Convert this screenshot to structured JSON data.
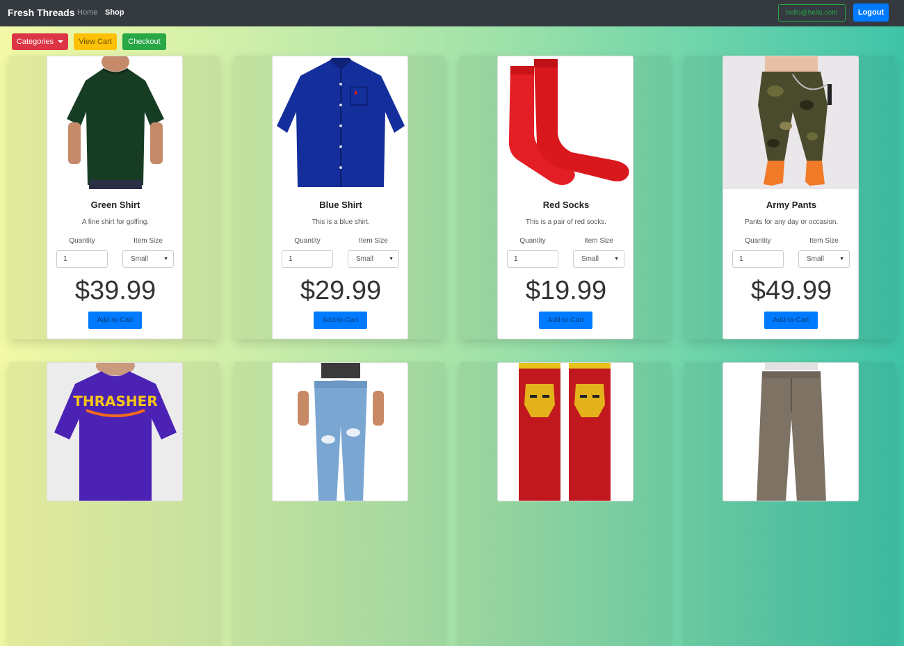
{
  "navbar": {
    "brand": "Fresh Threads",
    "links": [
      "Home",
      "Shop"
    ],
    "email": "hello@hello.com",
    "logout_label": "Logout"
  },
  "toolbar": {
    "categories_label": "Categories",
    "view_cart_label": "View Cart",
    "checkout_label": "Checkout"
  },
  "labels": {
    "quantity": "Quantity",
    "item_size": "Item Size",
    "add_to_cart": "Add-to-Cart"
  },
  "products": [
    {
      "name": "Green Shirt",
      "description": "A fine shirt for golfing.",
      "price": "$39.99",
      "quantity": "1",
      "size": "Small"
    },
    {
      "name": "Blue Shirt",
      "description": "This is a blue shirt.",
      "price": "$29.99",
      "quantity": "1",
      "size": "Small"
    },
    {
      "name": "Red Socks",
      "description": "This is a pair of red socks.",
      "price": "$19.99",
      "quantity": "1",
      "size": "Small"
    },
    {
      "name": "Army Pants",
      "description": "Pants for any day or occasion.",
      "price": "$49.99",
      "quantity": "1",
      "size": "Small"
    }
  ],
  "colors": {
    "navbar": "#343a40",
    "primary": "#007bff",
    "danger": "#dc3545",
    "warning": "#ffc107",
    "success": "#28a745"
  }
}
